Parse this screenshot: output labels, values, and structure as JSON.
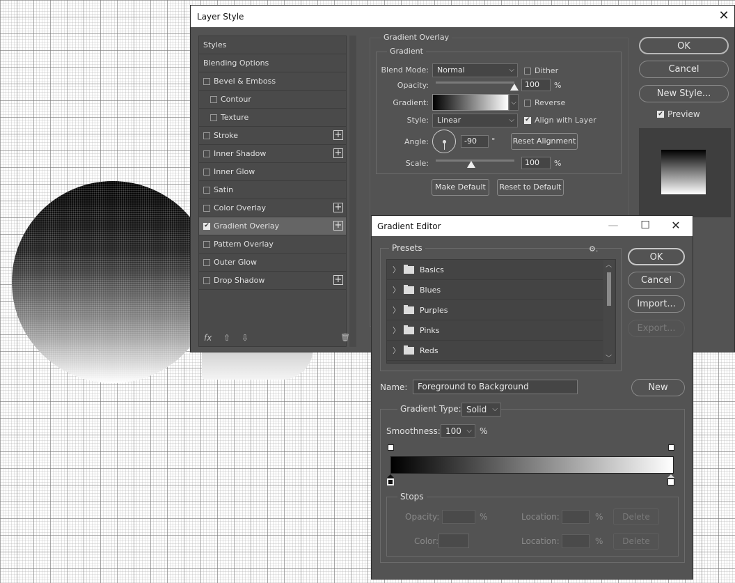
{
  "layer_style": {
    "title": "Layer Style",
    "close": "✕",
    "styles_list": [
      {
        "label": "Styles",
        "checkbox": false,
        "checked": false,
        "plus": false,
        "sub": false,
        "selected": false
      },
      {
        "label": "Blending Options",
        "checkbox": false,
        "checked": false,
        "plus": false,
        "sub": false,
        "selected": false
      },
      {
        "label": "Bevel & Emboss",
        "checkbox": true,
        "checked": false,
        "plus": false,
        "sub": false,
        "selected": false
      },
      {
        "label": "Contour",
        "checkbox": true,
        "checked": false,
        "plus": false,
        "sub": true,
        "selected": false
      },
      {
        "label": "Texture",
        "checkbox": true,
        "checked": false,
        "plus": false,
        "sub": true,
        "selected": false
      },
      {
        "label": "Stroke",
        "checkbox": true,
        "checked": false,
        "plus": true,
        "sub": false,
        "selected": false
      },
      {
        "label": "Inner Shadow",
        "checkbox": true,
        "checked": false,
        "plus": true,
        "sub": false,
        "selected": false
      },
      {
        "label": "Inner Glow",
        "checkbox": true,
        "checked": false,
        "plus": false,
        "sub": false,
        "selected": false
      },
      {
        "label": "Satin",
        "checkbox": true,
        "checked": false,
        "plus": false,
        "sub": false,
        "selected": false
      },
      {
        "label": "Color Overlay",
        "checkbox": true,
        "checked": false,
        "plus": true,
        "sub": false,
        "selected": false
      },
      {
        "label": "Gradient Overlay",
        "checkbox": true,
        "checked": true,
        "plus": true,
        "sub": false,
        "selected": true
      },
      {
        "label": "Pattern Overlay",
        "checkbox": true,
        "checked": false,
        "plus": false,
        "sub": false,
        "selected": false
      },
      {
        "label": "Outer Glow",
        "checkbox": true,
        "checked": false,
        "plus": false,
        "sub": false,
        "selected": false
      },
      {
        "label": "Drop Shadow",
        "checkbox": true,
        "checked": false,
        "plus": true,
        "sub": false,
        "selected": false
      }
    ],
    "footer": {
      "fx": "fx",
      "up": "⇧",
      "down": "⇩",
      "trash": "🗑"
    },
    "gradient_overlay": {
      "section_title": "Gradient Overlay",
      "group_title": "Gradient",
      "blend_mode_label": "Blend Mode:",
      "blend_mode_value": "Normal",
      "dither_label": "Dither",
      "opacity_label": "Opacity:",
      "opacity_value": "100",
      "opacity_unit": "%",
      "opacity_level": 1.0,
      "gradient_label": "Gradient:",
      "reverse_label": "Reverse",
      "style_label": "Style:",
      "style_value": "Linear",
      "align_label": "Align with Layer",
      "angle_label": "Angle:",
      "angle_value": "-90",
      "angle_unit": "°",
      "reset_alignment": "Reset Alignment",
      "scale_label": "Scale:",
      "scale_value": "100",
      "scale_unit": "%",
      "scale_level": 0.45,
      "make_default": "Make Default",
      "reset_default": "Reset to Default"
    },
    "buttons": {
      "ok": "OK",
      "cancel": "Cancel",
      "new_style": "New Style...",
      "preview": "Preview"
    }
  },
  "gradient_editor": {
    "title": "Gradient Editor",
    "minimize": "—",
    "maximize": "☐",
    "close": "✕",
    "presets_label": "Presets",
    "gear": "⚙.",
    "presets": [
      "Basics",
      "Blues",
      "Purples",
      "Pinks",
      "Reds"
    ],
    "buttons": {
      "ok": "OK",
      "cancel": "Cancel",
      "import": "Import...",
      "export": "Export...",
      "new": "New"
    },
    "name_label": "Name:",
    "name_value": "Foreground to Background",
    "gradient_type_label": "Gradient Type:",
    "gradient_type_value": "Solid",
    "smoothness_label": "Smoothness:",
    "smoothness_value": "100",
    "smoothness_unit": "%",
    "stops": {
      "title": "Stops",
      "opacity_label": "Opacity:",
      "opacity_unit": "%",
      "location_label": "Location:",
      "location_unit": "%",
      "delete": "Delete",
      "color_label": "Color:"
    }
  }
}
